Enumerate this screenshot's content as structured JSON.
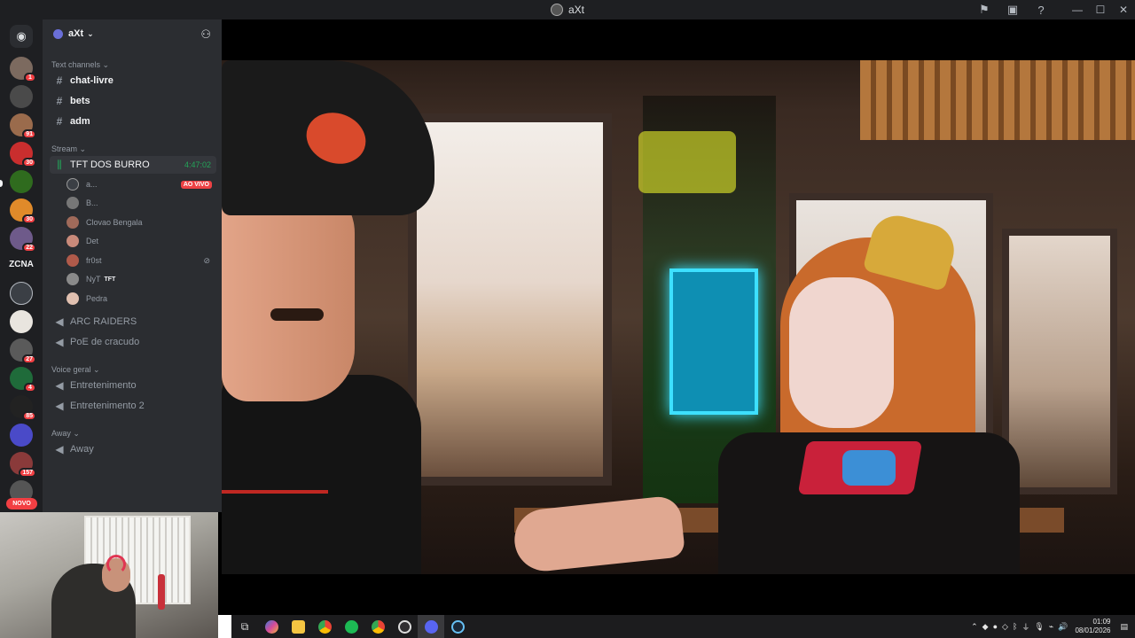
{
  "window": {
    "title": "aXt",
    "controls": {
      "minimize": "—",
      "maximize": "☐",
      "close": "✕"
    },
    "toolbar_icons": [
      "inbox-icon",
      "screen-share-icon",
      "help-icon"
    ]
  },
  "server_rail": {
    "badges": [
      "1",
      "",
      "91",
      "30",
      "",
      "30",
      "22",
      "",
      "",
      "",
      "27",
      "4",
      "85",
      "",
      "157"
    ],
    "zcna_label": "ZCNA",
    "novo_label": "NOVO"
  },
  "server": {
    "name": "aXt",
    "invite_icon": "add-member-icon"
  },
  "categories": {
    "text": "Text channels",
    "stream": "Stream",
    "voice": "Voice geral",
    "away": "Away"
  },
  "text_channels": [
    "chat-livre",
    "bets",
    "adm"
  ],
  "stream_channel": {
    "name": "TFT DOS BURRO",
    "time": "4:47:02"
  },
  "stream_users": [
    {
      "name": "a...",
      "badge": "AO VIVO"
    },
    {
      "name": "B...",
      "badge": ""
    },
    {
      "name": "Clovao Bengala",
      "badge": ""
    },
    {
      "name": "Det",
      "badge": ""
    },
    {
      "name": "fr0st",
      "badge": ""
    },
    {
      "name": "NyT",
      "badge": "TFT"
    },
    {
      "name": "Pedra",
      "badge": ""
    }
  ],
  "voice_channels_stream": [
    "ARC RAIDERS",
    "PoE de cracudo"
  ],
  "voice_channels_geral": [
    "Entretenimento",
    "Entretenimento 2"
  ],
  "voice_channels_away": [
    "Away"
  ],
  "taskbar": {
    "time": "01:09",
    "date": "08/01/2026"
  },
  "colors": {
    "live": "#ed4245",
    "online_green": "#23a559",
    "background": "#2b2d31"
  }
}
